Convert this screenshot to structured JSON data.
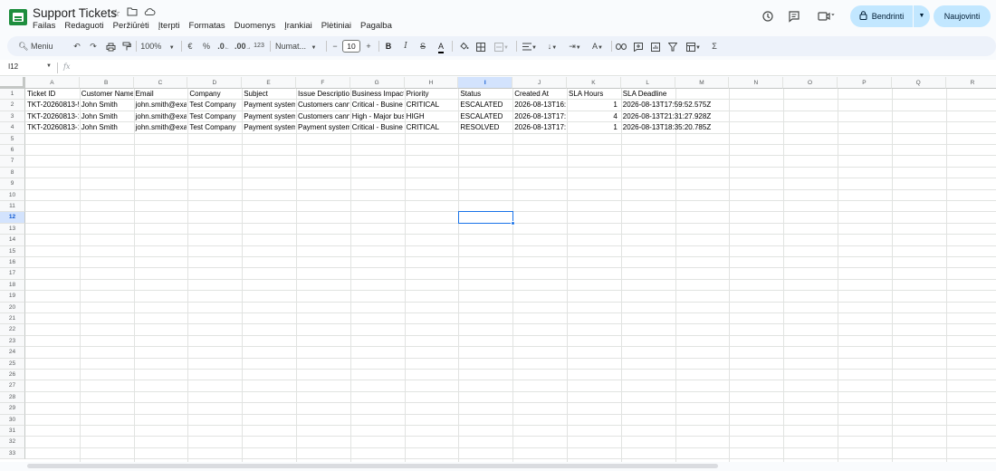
{
  "app": {
    "title": "Support Tickets",
    "menus": [
      "Failas",
      "Redaguoti",
      "Peržiūrėti",
      "Įterpti",
      "Formatas",
      "Duomenys",
      "Įrankiai",
      "Plėtiniai",
      "Pagalba"
    ],
    "share_label": "Bendrinti",
    "update_label": "Naujovinti"
  },
  "toolbar": {
    "menu_label": "Meniu",
    "zoom": "100%",
    "currency": "€",
    "percent": "%",
    "decrease_decimals": ".0",
    "increase_decimals": ".00",
    "number_format": "123",
    "font_name": "Numat...",
    "font_size": "10"
  },
  "formula_bar": {
    "name_box": "I12",
    "fx": "fx",
    "content": ""
  },
  "sheet": {
    "columns": [
      "A",
      "B",
      "C",
      "D",
      "E",
      "F",
      "G",
      "H",
      "I",
      "J",
      "K",
      "L",
      "M",
      "N",
      "O",
      "P",
      "Q",
      "R"
    ],
    "selected_column": "I",
    "selected_row": 12,
    "row_count": 33,
    "rows": [
      [
        "Ticket ID",
        "Customer Name",
        "Email",
        "Company",
        "Subject",
        "Issue Description",
        "Business Impact",
        "Priority",
        "Status",
        "Created At",
        "SLA Hours",
        "SLA Deadline"
      ],
      [
        "TKT-20260813-5",
        "John Smith",
        "john.smith@exa",
        "Test Company",
        "Payment system",
        "Customers cann",
        "Critical - Busine",
        "CRITICAL",
        "ESCALATED",
        "2026-08-13T16:5",
        "1",
        "2026-08-13T17:59:52.575Z"
      ],
      [
        "TKT-20260813-1",
        "John Smith",
        "john.smith@exa",
        "Test Company",
        "Payment system",
        "Customers cann",
        "High - Major bus",
        "HIGH",
        "ESCALATED",
        "2026-08-13T17:3",
        "4",
        "2026-08-13T21:31:27.928Z"
      ],
      [
        "TKT-20260813-1",
        "John Smith",
        "john.smith@exa",
        "Test Company",
        "Payment system",
        "Payment system",
        "Critical - Busine",
        "CRITICAL",
        "RESOLVED",
        "2026-08-13T17:3",
        "1",
        "2026-08-13T18:35:20.785Z"
      ]
    ]
  }
}
